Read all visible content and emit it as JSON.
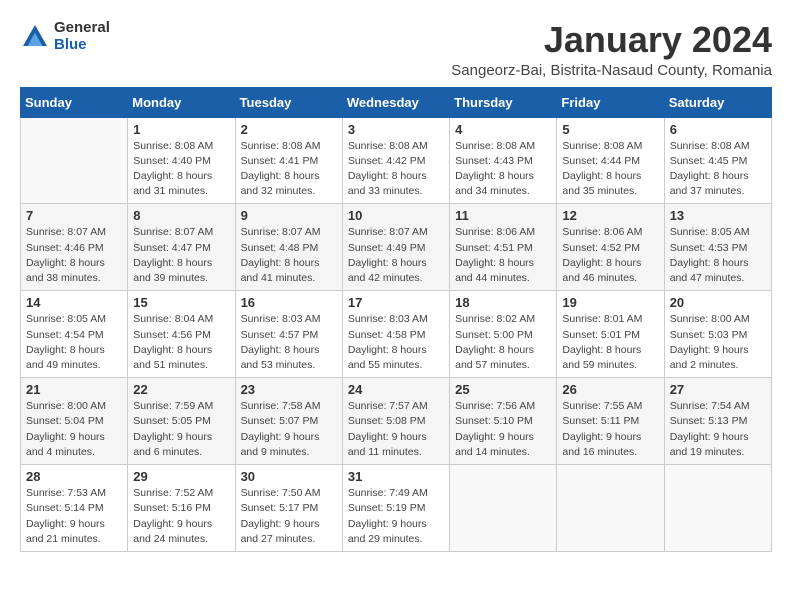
{
  "logo": {
    "general": "General",
    "blue": "Blue"
  },
  "calendar": {
    "title": "January 2024",
    "subtitle": "Sangeorz-Bai, Bistrita-Nasaud County, Romania"
  },
  "weekdays": [
    "Sunday",
    "Monday",
    "Tuesday",
    "Wednesday",
    "Thursday",
    "Friday",
    "Saturday"
  ],
  "weeks": [
    [
      {
        "day": "",
        "info": ""
      },
      {
        "day": "1",
        "info": "Sunrise: 8:08 AM\nSunset: 4:40 PM\nDaylight: 8 hours\nand 31 minutes."
      },
      {
        "day": "2",
        "info": "Sunrise: 8:08 AM\nSunset: 4:41 PM\nDaylight: 8 hours\nand 32 minutes."
      },
      {
        "day": "3",
        "info": "Sunrise: 8:08 AM\nSunset: 4:42 PM\nDaylight: 8 hours\nand 33 minutes."
      },
      {
        "day": "4",
        "info": "Sunrise: 8:08 AM\nSunset: 4:43 PM\nDaylight: 8 hours\nand 34 minutes."
      },
      {
        "day": "5",
        "info": "Sunrise: 8:08 AM\nSunset: 4:44 PM\nDaylight: 8 hours\nand 35 minutes."
      },
      {
        "day": "6",
        "info": "Sunrise: 8:08 AM\nSunset: 4:45 PM\nDaylight: 8 hours\nand 37 minutes."
      }
    ],
    [
      {
        "day": "7",
        "info": "Sunrise: 8:07 AM\nSunset: 4:46 PM\nDaylight: 8 hours\nand 38 minutes."
      },
      {
        "day": "8",
        "info": "Sunrise: 8:07 AM\nSunset: 4:47 PM\nDaylight: 8 hours\nand 39 minutes."
      },
      {
        "day": "9",
        "info": "Sunrise: 8:07 AM\nSunset: 4:48 PM\nDaylight: 8 hours\nand 41 minutes."
      },
      {
        "day": "10",
        "info": "Sunrise: 8:07 AM\nSunset: 4:49 PM\nDaylight: 8 hours\nand 42 minutes."
      },
      {
        "day": "11",
        "info": "Sunrise: 8:06 AM\nSunset: 4:51 PM\nDaylight: 8 hours\nand 44 minutes."
      },
      {
        "day": "12",
        "info": "Sunrise: 8:06 AM\nSunset: 4:52 PM\nDaylight: 8 hours\nand 46 minutes."
      },
      {
        "day": "13",
        "info": "Sunrise: 8:05 AM\nSunset: 4:53 PM\nDaylight: 8 hours\nand 47 minutes."
      }
    ],
    [
      {
        "day": "14",
        "info": "Sunrise: 8:05 AM\nSunset: 4:54 PM\nDaylight: 8 hours\nand 49 minutes."
      },
      {
        "day": "15",
        "info": "Sunrise: 8:04 AM\nSunset: 4:56 PM\nDaylight: 8 hours\nand 51 minutes."
      },
      {
        "day": "16",
        "info": "Sunrise: 8:03 AM\nSunset: 4:57 PM\nDaylight: 8 hours\nand 53 minutes."
      },
      {
        "day": "17",
        "info": "Sunrise: 8:03 AM\nSunset: 4:58 PM\nDaylight: 8 hours\nand 55 minutes."
      },
      {
        "day": "18",
        "info": "Sunrise: 8:02 AM\nSunset: 5:00 PM\nDaylight: 8 hours\nand 57 minutes."
      },
      {
        "day": "19",
        "info": "Sunrise: 8:01 AM\nSunset: 5:01 PM\nDaylight: 8 hours\nand 59 minutes."
      },
      {
        "day": "20",
        "info": "Sunrise: 8:00 AM\nSunset: 5:03 PM\nDaylight: 9 hours\nand 2 minutes."
      }
    ],
    [
      {
        "day": "21",
        "info": "Sunrise: 8:00 AM\nSunset: 5:04 PM\nDaylight: 9 hours\nand 4 minutes."
      },
      {
        "day": "22",
        "info": "Sunrise: 7:59 AM\nSunset: 5:05 PM\nDaylight: 9 hours\nand 6 minutes."
      },
      {
        "day": "23",
        "info": "Sunrise: 7:58 AM\nSunset: 5:07 PM\nDaylight: 9 hours\nand 9 minutes."
      },
      {
        "day": "24",
        "info": "Sunrise: 7:57 AM\nSunset: 5:08 PM\nDaylight: 9 hours\nand 11 minutes."
      },
      {
        "day": "25",
        "info": "Sunrise: 7:56 AM\nSunset: 5:10 PM\nDaylight: 9 hours\nand 14 minutes."
      },
      {
        "day": "26",
        "info": "Sunrise: 7:55 AM\nSunset: 5:11 PM\nDaylight: 9 hours\nand 16 minutes."
      },
      {
        "day": "27",
        "info": "Sunrise: 7:54 AM\nSunset: 5:13 PM\nDaylight: 9 hours\nand 19 minutes."
      }
    ],
    [
      {
        "day": "28",
        "info": "Sunrise: 7:53 AM\nSunset: 5:14 PM\nDaylight: 9 hours\nand 21 minutes."
      },
      {
        "day": "29",
        "info": "Sunrise: 7:52 AM\nSunset: 5:16 PM\nDaylight: 9 hours\nand 24 minutes."
      },
      {
        "day": "30",
        "info": "Sunrise: 7:50 AM\nSunset: 5:17 PM\nDaylight: 9 hours\nand 27 minutes."
      },
      {
        "day": "31",
        "info": "Sunrise: 7:49 AM\nSunset: 5:19 PM\nDaylight: 9 hours\nand 29 minutes."
      },
      {
        "day": "",
        "info": ""
      },
      {
        "day": "",
        "info": ""
      },
      {
        "day": "",
        "info": ""
      }
    ]
  ]
}
